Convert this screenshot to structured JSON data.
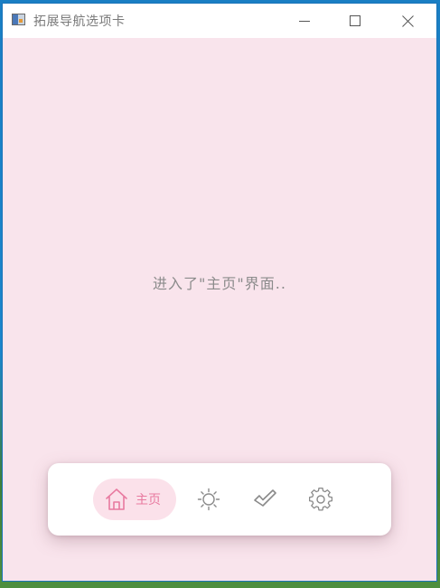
{
  "window": {
    "title": "拓展导航选项卡"
  },
  "content": {
    "message": "进入了\"主页\"界面.."
  },
  "nav": {
    "items": [
      {
        "icon": "home-icon",
        "label": "主页",
        "active": true
      },
      {
        "icon": "brightness-icon"
      },
      {
        "icon": "checkmark-icon"
      },
      {
        "icon": "settings-gear-icon"
      }
    ]
  },
  "colors": {
    "accent": "#e87aa0",
    "active_pill": "#fbe1ea",
    "background": "#f9e4ec",
    "icon_gray": "#8a8a8a"
  }
}
